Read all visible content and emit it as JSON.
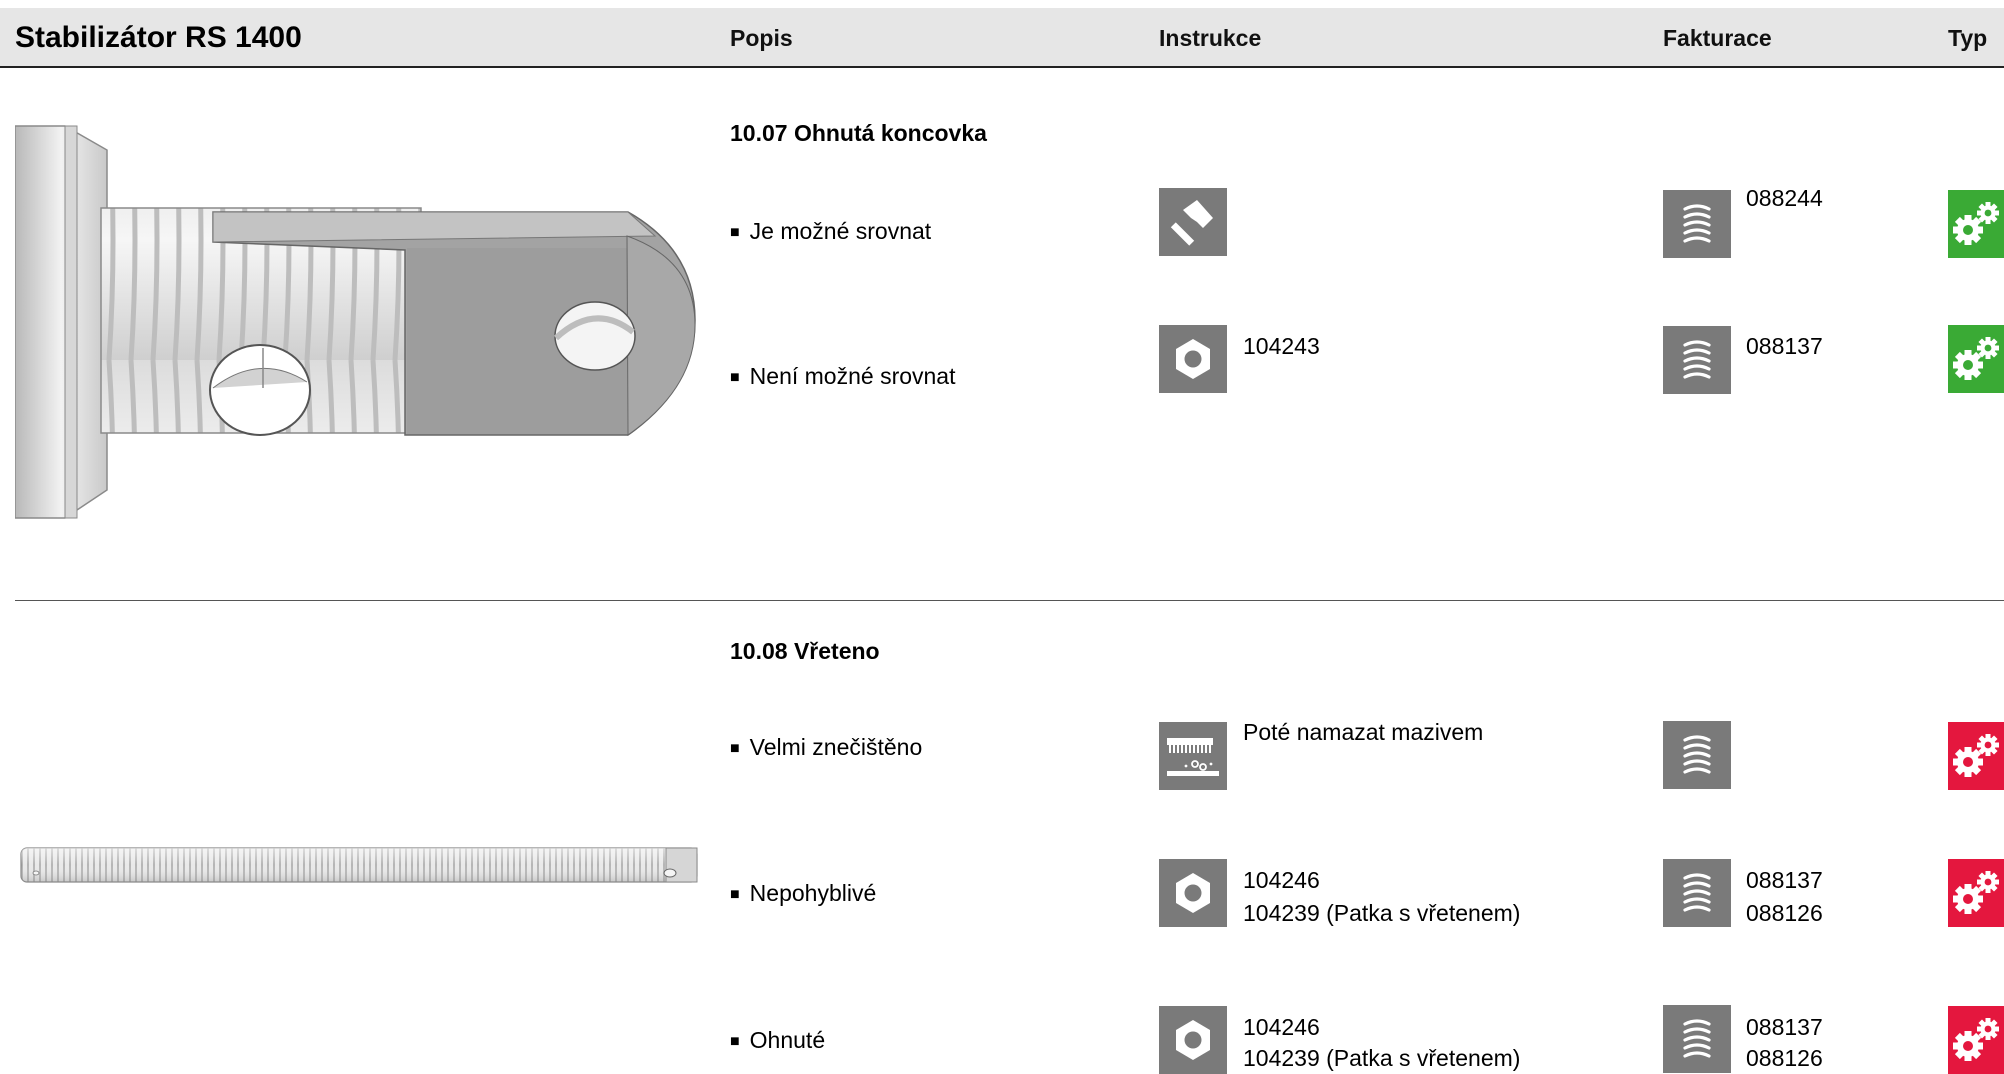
{
  "header": {
    "title": "Stabilizátor RS 1400",
    "col_popis": "Popis",
    "col_instrukce": "Instrukce",
    "col_fakturace": "Fakturace",
    "col_typ": "Typ"
  },
  "sections": [
    {
      "title": "10.07 Ohnutá koncovka",
      "items": [
        {
          "label": "Je možné srovnat",
          "instruction_icon": "hammer-icon",
          "instruction_lines": [],
          "billing_icon": "coil-spring-icon",
          "billing_lines": [
            "088244"
          ],
          "type_icon": "gears-icon",
          "type_color": "#3aaa35"
        },
        {
          "label": "Není možné srovnat",
          "instruction_icon": "hex-nut-icon",
          "instruction_lines": [
            "104243"
          ],
          "billing_icon": "coil-spring-icon",
          "billing_lines": [
            "088137"
          ],
          "type_icon": "gears-icon",
          "type_color": "#3aaa35"
        }
      ]
    },
    {
      "title": "10.08 Vřeteno",
      "items": [
        {
          "label": "Velmi znečištěno",
          "instruction_icon": "grease-brush-icon",
          "instruction_lines": [
            "Poté namazat mazivem"
          ],
          "billing_icon": "coil-spring-icon",
          "billing_lines": [],
          "type_icon": "gears-icon",
          "type_color": "#e4173e"
        },
        {
          "label": "Nepohyblivé",
          "instruction_icon": "hex-nut-icon",
          "instruction_lines": [
            "104246",
            "104239 (Patka s vřetenem)"
          ],
          "billing_icon": "coil-spring-icon",
          "billing_lines": [
            "088137",
            "088126"
          ],
          "type_icon": "gears-icon",
          "type_color": "#e4173e"
        },
        {
          "label": "Ohnuté",
          "instruction_icon": "hex-nut-icon",
          "instruction_lines": [
            "104246",
            "104239 (Patka s vřetenem)"
          ],
          "billing_icon": "coil-spring-icon",
          "billing_lines": [
            "088137",
            "088126"
          ],
          "type_icon": "gears-icon",
          "type_color": "#e4173e"
        }
      ]
    }
  ]
}
